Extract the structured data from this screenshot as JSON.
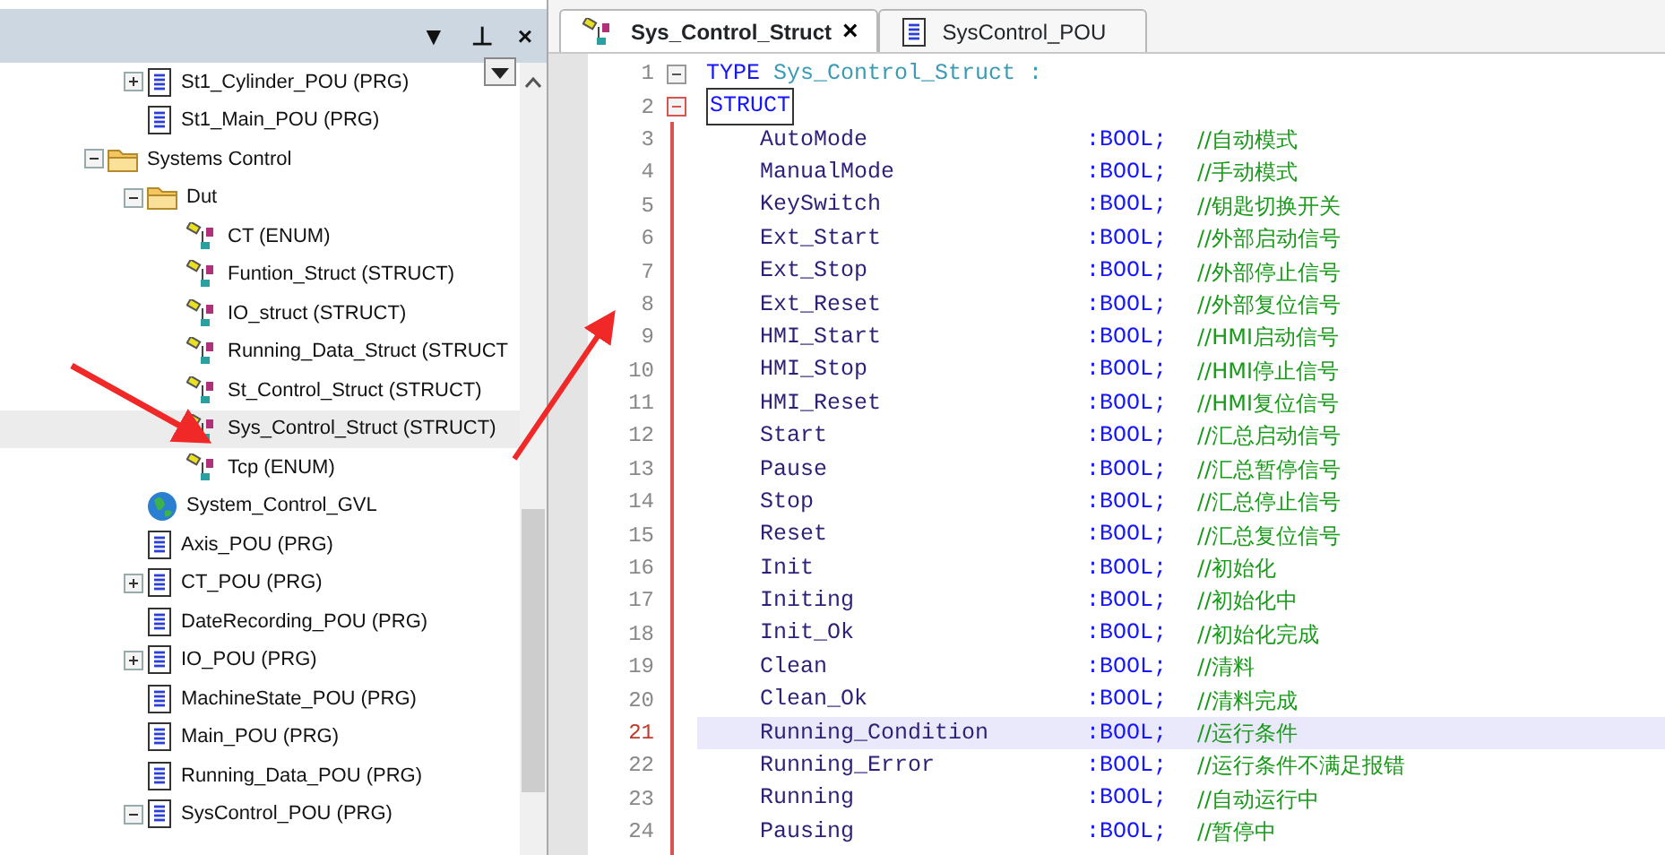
{
  "panel_header": {
    "buttons": [
      "▼",
      "⊥",
      "×"
    ]
  },
  "tree_above": [
    {
      "label": "St1_Cylinder_POU (PRG)",
      "kind": "pou",
      "expanded": false,
      "selected": false
    },
    {
      "label": "St1_Main_POU (PRG)",
      "kind": "pou",
      "selected": false
    }
  ],
  "tree": [
    {
      "label": "Systems Control",
      "kind": "folder",
      "expanded": true,
      "selected": false,
      "children": [
        {
          "label": "Dut",
          "kind": "folder",
          "expanded": true,
          "selected": false,
          "children": [
            {
              "label": "CT (ENUM)",
              "kind": "dut",
              "selected": false
            },
            {
              "label": "Funtion_Struct (STRUCT)",
              "kind": "dut",
              "selected": false
            },
            {
              "label": "IO_struct (STRUCT)",
              "kind": "dut",
              "selected": false
            },
            {
              "label": "Running_Data_Struct (STRUCT",
              "kind": "dut",
              "selected": false
            },
            {
              "label": "St_Control_Struct (STRUCT)",
              "kind": "dut",
              "selected": false
            },
            {
              "label": "Sys_Control_Struct (STRUCT)",
              "kind": "dut",
              "selected": true
            },
            {
              "label": "Tcp (ENUM)",
              "kind": "dut",
              "selected": false
            }
          ]
        },
        {
          "label": "System_Control_GVL",
          "kind": "gvl",
          "selected": false
        },
        {
          "label": "Axis_POU (PRG)",
          "kind": "pou",
          "selected": false
        },
        {
          "label": "CT_POU (PRG)",
          "kind": "pou",
          "expanded": false,
          "selected": false
        },
        {
          "label": "DateRecording_POU (PRG)",
          "kind": "pou",
          "selected": false
        },
        {
          "label": "IO_POU (PRG)",
          "kind": "pou",
          "expanded": false,
          "selected": false
        },
        {
          "label": "MachineState_POU (PRG)",
          "kind": "pou",
          "selected": false
        },
        {
          "label": "Main_POU (PRG)",
          "kind": "pou",
          "selected": false
        },
        {
          "label": "Running_Data_POU (PRG)",
          "kind": "pou",
          "selected": false
        },
        {
          "label": "SysControl_POU (PRG)",
          "kind": "pou",
          "expanded": true,
          "selected": false
        }
      ]
    }
  ],
  "tabs": [
    {
      "label": "Sys_Control_Struct",
      "kind": "dut",
      "selected": true,
      "close": "×"
    },
    {
      "label": "SysControl_POU",
      "kind": "pou",
      "selected": false
    }
  ],
  "code_lines": [
    {
      "number": "1",
      "kind": "type",
      "keyword": "TYPE",
      "name": "Sys_Control_Struct",
      "punct": ":",
      "expanded": true,
      "selected": false
    },
    {
      "number": "2",
      "kind": "struct",
      "keyword": "STRUCT",
      "expanded": true,
      "selected": false
    },
    {
      "number": "3",
      "kind": "field",
      "name": "AutoMode",
      "type": ":BOOL;",
      "comment": "//自动模式",
      "selected": false
    },
    {
      "number": "4",
      "kind": "field",
      "name": "ManualMode",
      "type": ":BOOL;",
      "comment": "//手动模式",
      "selected": false
    },
    {
      "number": "5",
      "kind": "field",
      "name": "KeySwitch",
      "type": ":BOOL;",
      "comment": "//钥匙切换开关",
      "selected": false
    },
    {
      "number": "6",
      "kind": "field",
      "name": "Ext_Start",
      "type": ":BOOL;",
      "comment": "//外部启动信号",
      "selected": false
    },
    {
      "number": "7",
      "kind": "field",
      "name": "Ext_Stop",
      "type": ":BOOL;",
      "comment": "//外部停止信号",
      "selected": false
    },
    {
      "number": "8",
      "kind": "field",
      "name": "Ext_Reset",
      "type": ":BOOL;",
      "comment": "//外部复位信号",
      "selected": false
    },
    {
      "number": "9",
      "kind": "field",
      "name": "HMI_Start",
      "type": ":BOOL;",
      "comment": "//HMI启动信号",
      "selected": false
    },
    {
      "number": "10",
      "kind": "field",
      "name": "HMI_Stop",
      "type": ":BOOL;",
      "comment": "//HMI停止信号",
      "selected": false
    },
    {
      "number": "11",
      "kind": "field",
      "name": "HMI_Reset",
      "type": ":BOOL;",
      "comment": "//HMI复位信号",
      "selected": false
    },
    {
      "number": "12",
      "kind": "field",
      "name": "Start",
      "type": ":BOOL;",
      "comment": "//汇总启动信号",
      "selected": false
    },
    {
      "number": "13",
      "kind": "field",
      "name": "Pause",
      "type": ":BOOL;",
      "comment": "//汇总暂停信号",
      "selected": false
    },
    {
      "number": "14",
      "kind": "field",
      "name": "Stop",
      "type": ":BOOL;",
      "comment": "//汇总停止信号",
      "selected": false
    },
    {
      "number": "15",
      "kind": "field",
      "name": "Reset",
      "type": ":BOOL;",
      "comment": "//汇总复位信号",
      "selected": false
    },
    {
      "number": "16",
      "kind": "field",
      "name": "Init",
      "type": ":BOOL;",
      "comment": "//初始化",
      "selected": false
    },
    {
      "number": "17",
      "kind": "field",
      "name": "Initing",
      "type": ":BOOL;",
      "comment": "//初始化中",
      "selected": false
    },
    {
      "number": "18",
      "kind": "field",
      "name": "Init_Ok",
      "type": ":BOOL;",
      "comment": "//初始化完成",
      "selected": false
    },
    {
      "number": "19",
      "kind": "field",
      "name": "Clean",
      "type": ":BOOL;",
      "comment": "//清料",
      "selected": false
    },
    {
      "number": "20",
      "kind": "field",
      "name": "Clean_Ok",
      "type": ":BOOL;",
      "comment": "//清料完成",
      "selected": false
    },
    {
      "number": "21",
      "kind": "field",
      "name": "Running_Condition",
      "type": ":BOOL;",
      "comment": "//运行条件",
      "selected": true
    },
    {
      "number": "22",
      "kind": "field",
      "name": "Running_Error",
      "type": ":BOOL;",
      "comment": "//运行条件不满足报错",
      "selected": false
    },
    {
      "number": "23",
      "kind": "field",
      "name": "Running",
      "type": ":BOOL;",
      "comment": "//自动运行中",
      "selected": false
    },
    {
      "number": "24",
      "kind": "field",
      "name": "Pausing",
      "type": ":BOOL;",
      "comment": "//暂停中",
      "selected": false
    }
  ]
}
